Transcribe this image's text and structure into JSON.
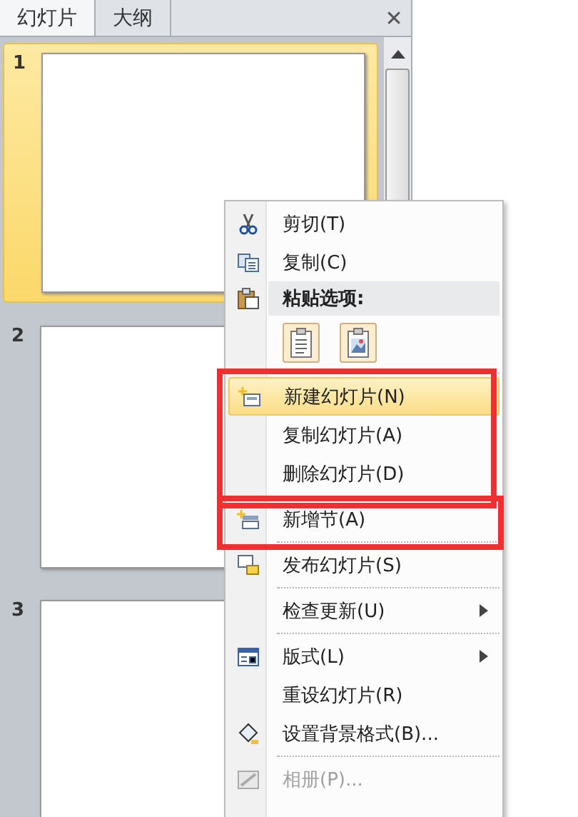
{
  "panel": {
    "tabs": [
      {
        "label": "幻灯片",
        "selected": true
      },
      {
        "label": "大纲",
        "selected": false
      }
    ],
    "close": "✕",
    "slides": [
      {
        "number": "1",
        "selected": true
      },
      {
        "number": "2",
        "selected": false
      },
      {
        "number": "3",
        "selected": false
      }
    ]
  },
  "context_menu": {
    "clipboard_items": [
      {
        "label": "剪切(T)",
        "selected": false,
        "disabled": false,
        "submenu": false
      },
      {
        "label": "复制(C)",
        "selected": false,
        "disabled": false,
        "submenu": false
      }
    ],
    "paste_header": "粘贴选项:",
    "groups": [
      {
        "items": [
          {
            "label": "新建幻灯片(N)",
            "selected": true,
            "disabled": false,
            "submenu": false
          },
          {
            "label": "复制幻灯片(A)",
            "selected": false,
            "disabled": false,
            "submenu": false
          },
          {
            "label": "删除幻灯片(D)",
            "selected": false,
            "disabled": false,
            "submenu": false
          }
        ]
      },
      {
        "items": [
          {
            "label": "新增节(A)",
            "selected": false,
            "disabled": false,
            "submenu": false
          }
        ]
      },
      {
        "items": [
          {
            "label": "发布幻灯片(S)",
            "selected": false,
            "disabled": false,
            "submenu": false
          }
        ]
      },
      {
        "items": [
          {
            "label": "检查更新(U)",
            "selected": false,
            "disabled": false,
            "submenu": true
          }
        ]
      },
      {
        "items": [
          {
            "label": "版式(L)",
            "selected": false,
            "disabled": false,
            "submenu": true
          },
          {
            "label": "重设幻灯片(R)",
            "selected": false,
            "disabled": false,
            "submenu": false
          },
          {
            "label": "设置背景格式(B)...",
            "selected": false,
            "disabled": false,
            "submenu": false
          }
        ]
      },
      {
        "items": [
          {
            "label": "相册(P)...",
            "selected": false,
            "disabled": true,
            "submenu": false
          }
        ]
      }
    ]
  },
  "annotations": [
    {
      "kind": "frame"
    },
    {
      "kind": "frame"
    }
  ]
}
